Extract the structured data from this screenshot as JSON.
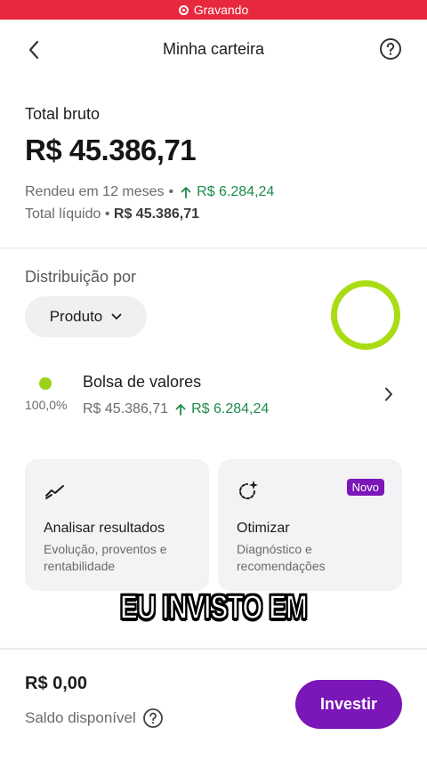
{
  "status_bar": {
    "recording_label": "Gravando",
    "color": "#e8283d"
  },
  "header": {
    "title": "Minha carteira",
    "back_icon": "chevron-left-icon",
    "help_icon": "question-circle-icon"
  },
  "summary": {
    "total_label": "Total bruto",
    "total_value": "R$ 45.386,71",
    "yield_label": "Rendeu em 12 meses",
    "separator": "•",
    "yield_value": "R$ 6.284,24",
    "net_label": "Total líquido",
    "net_value": "R$ 45.386,71"
  },
  "distribution": {
    "label": "Distribuição por",
    "selector_value": "Produto",
    "chart_color": "#aadc14",
    "items": [
      {
        "name": "Bolsa de valores",
        "percent": "100,0%",
        "value": "R$ 45.386,71",
        "yield": "R$ 6.284,24",
        "color": "#9dd11a"
      }
    ]
  },
  "cards": [
    {
      "title": "Analisar resultados",
      "description": "Evolução, proventos e rentabilidade",
      "icon": "trend-chart-icon"
    },
    {
      "title": "Otimizar",
      "description": "Diagnóstico e recomendações",
      "icon": "sparkle-circle-icon",
      "badge": "Novo"
    }
  ],
  "caption": "EU INVISTO EM",
  "footer": {
    "balance_value": "R$ 0,00",
    "balance_label": "Saldo disponível",
    "invest_button": "Investir",
    "accent_color": "#7b16b8"
  }
}
